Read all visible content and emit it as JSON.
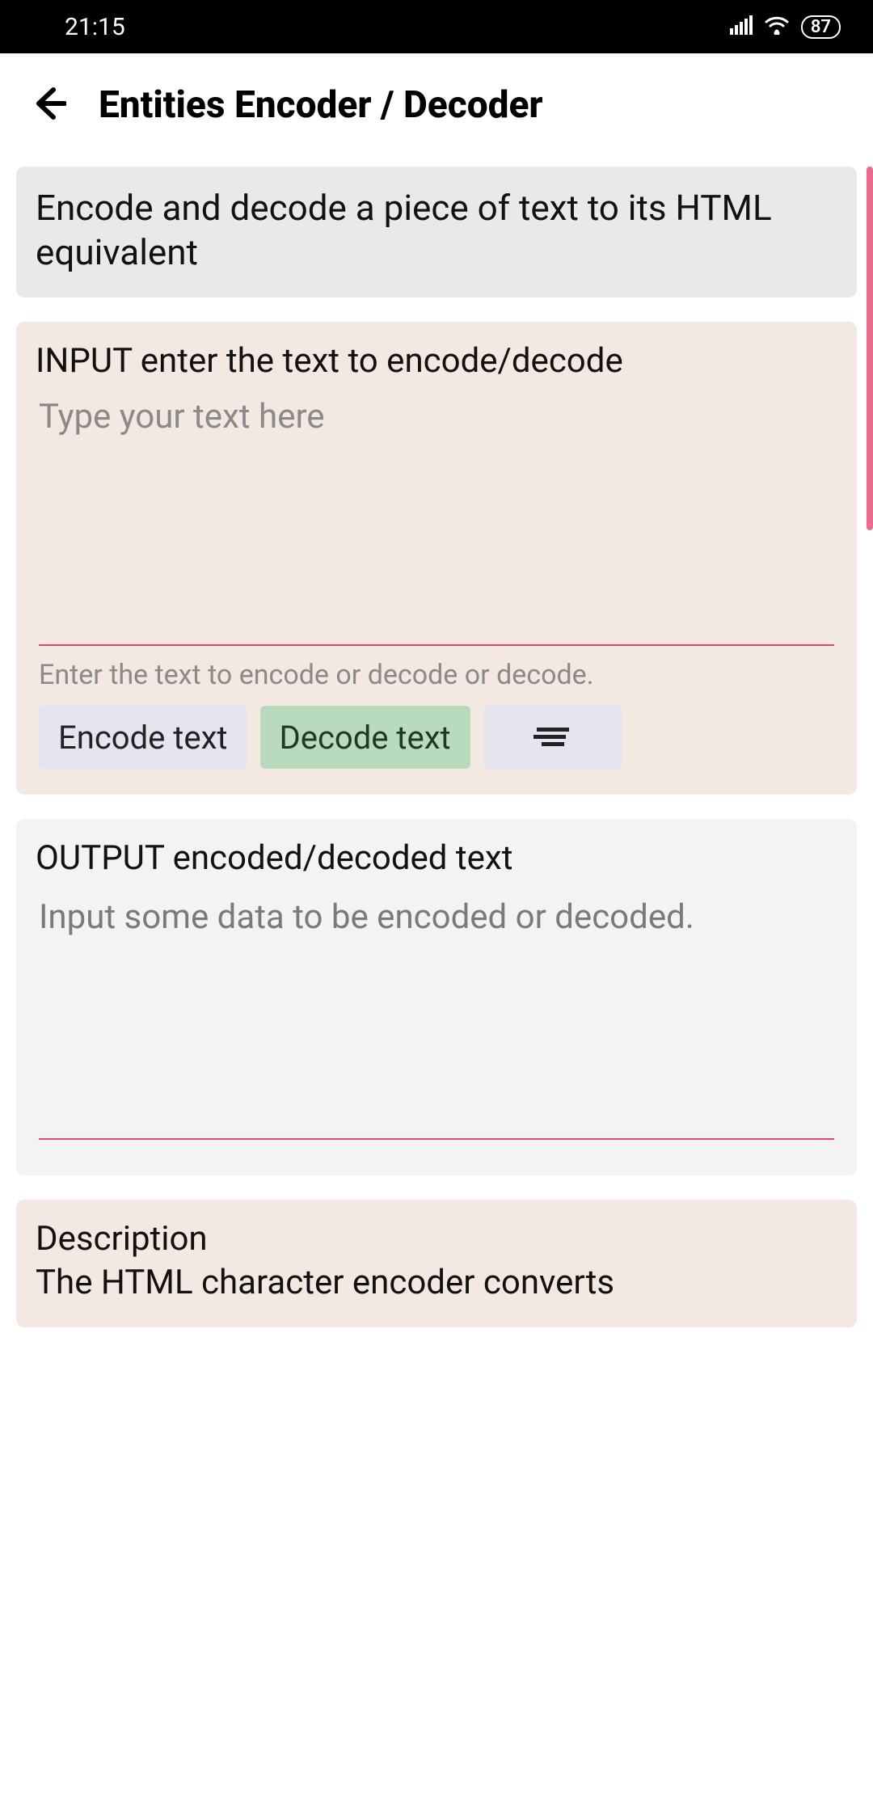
{
  "status": {
    "time": "21:15",
    "battery": "87"
  },
  "header": {
    "title": "Entities Encoder / Decoder"
  },
  "intro": {
    "text": "Encode and decode a piece of text to its HTML equivalent"
  },
  "input": {
    "title": "INPUT enter the text to encode/decode",
    "placeholder": "Type your text here",
    "value": "",
    "helper": "Enter the text to encode or decode or decode.",
    "encode_label": "Encode text",
    "decode_label": "Decode text"
  },
  "output": {
    "title": "OUTPUT encoded/decoded text",
    "placeholder": "Input some data to be encoded or decoded."
  },
  "description": {
    "heading": "Description",
    "body": "The HTML character encoder converts"
  }
}
